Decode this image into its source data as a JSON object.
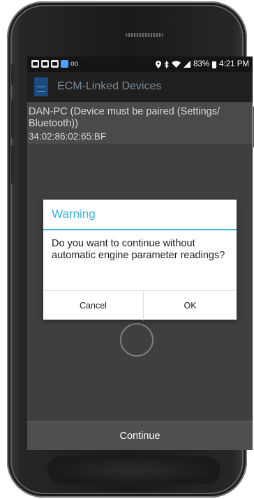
{
  "status_bar": {
    "voicemail": "oo",
    "battery_percent": "83%",
    "time": "4:21 PM"
  },
  "action_bar": {
    "title": "ECM-Linked Devices"
  },
  "device_list": [
    {
      "name": "DAN-PC (Device must be paired (Settings/ Bluetooth))",
      "address": "34:02:86:02:65:BF"
    }
  ],
  "dialog": {
    "title": "Warning",
    "message": "Do you want to continue without automatic engine parameter readings?",
    "cancel_label": "Cancel",
    "ok_label": "OK"
  },
  "footer": {
    "continue_label": "Continue"
  },
  "colors": {
    "dialog_accent": "#33b5e5",
    "action_bar_title": "#7c8a99",
    "app_icon": "#1c4b82"
  },
  "icons": {
    "status_left": [
      "gallery-icon",
      "photo-icon",
      "calendar-icon",
      "notification-icon"
    ],
    "status_right": [
      "location-icon",
      "bluetooth-icon",
      "wifi-icon",
      "signal-icon",
      "battery-icon"
    ]
  }
}
